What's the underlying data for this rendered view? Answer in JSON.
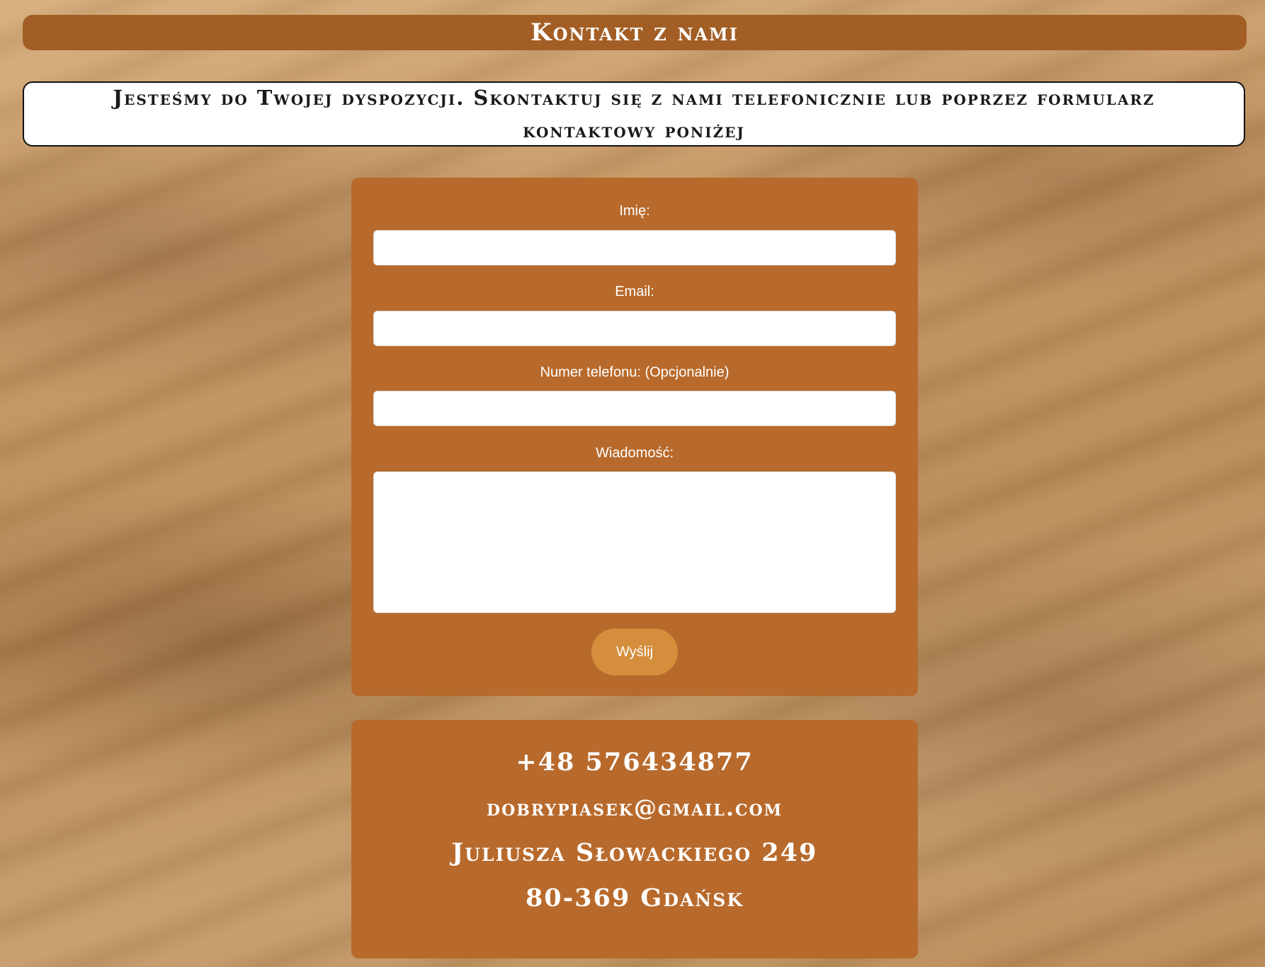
{
  "header": {
    "title": "Kontakt z nami"
  },
  "intro": {
    "text": "Jesteśmy do Twojej dyspozycji. Skontaktuj się z nami telefonicznie lub poprzez formularz kontaktowy poniżej"
  },
  "form": {
    "name_label": "Imię:",
    "name_value": "",
    "email_label": "Email:",
    "email_value": "",
    "phone_label": "Numer telefonu: (Opcjonalnie)",
    "phone_value": "",
    "message_label": "Wiadomość:",
    "message_value": "",
    "submit_label": "Wyślij"
  },
  "contact": {
    "phone": "+48 576434877",
    "email": "dobrypiasek@gmail.com",
    "street": "Juliusza Słowackiego 249",
    "city": "80-369 Gdańsk"
  },
  "colors": {
    "title_bar": "#a35e25",
    "panel": "#b86a2c",
    "button": "#d48e3c"
  }
}
